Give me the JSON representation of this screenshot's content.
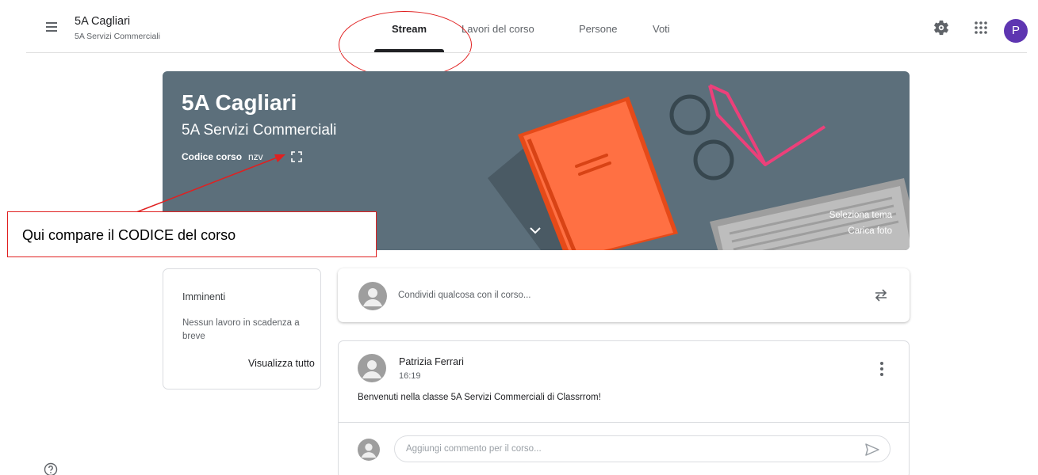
{
  "header": {
    "class_name": "5A Cagliari",
    "class_section": "5A Servizi Commerciali",
    "tabs": [
      {
        "label": "Stream"
      },
      {
        "label": "Lavori del corso"
      },
      {
        "label": "Persone"
      },
      {
        "label": "Voti"
      }
    ],
    "avatar_letter": "P",
    "icons": [
      "menu-icon",
      "gear-icon",
      "apps-grid-icon"
    ]
  },
  "banner": {
    "title": "5A Cagliari",
    "subtitle": "5A Servizi Commerciali",
    "code_label": "Codice corso",
    "code_value": "nzv",
    "select_theme": "Seleziona tema",
    "upload_photo": "Carica foto"
  },
  "annotation": {
    "text": "Qui compare il CODICE del corso"
  },
  "upcoming": {
    "title": "Imminenti",
    "empty_text": "Nessun lavoro in scadenza a breve",
    "view_all": "Visualizza tutto"
  },
  "share": {
    "placeholder": "Condividi qualcosa con il corso..."
  },
  "post": {
    "author": "Patrizia Ferrari",
    "time": "16:19",
    "body": "Benvenuti nella classe 5A Servizi Commerciali di Classrrom!",
    "comment_placeholder": "Aggiungi commento per il corso..."
  },
  "colors": {
    "banner": "#5c6f7b",
    "avatar": "#5e35b1",
    "annotation_red": "#e02020",
    "book_orange": "#ff7043"
  }
}
